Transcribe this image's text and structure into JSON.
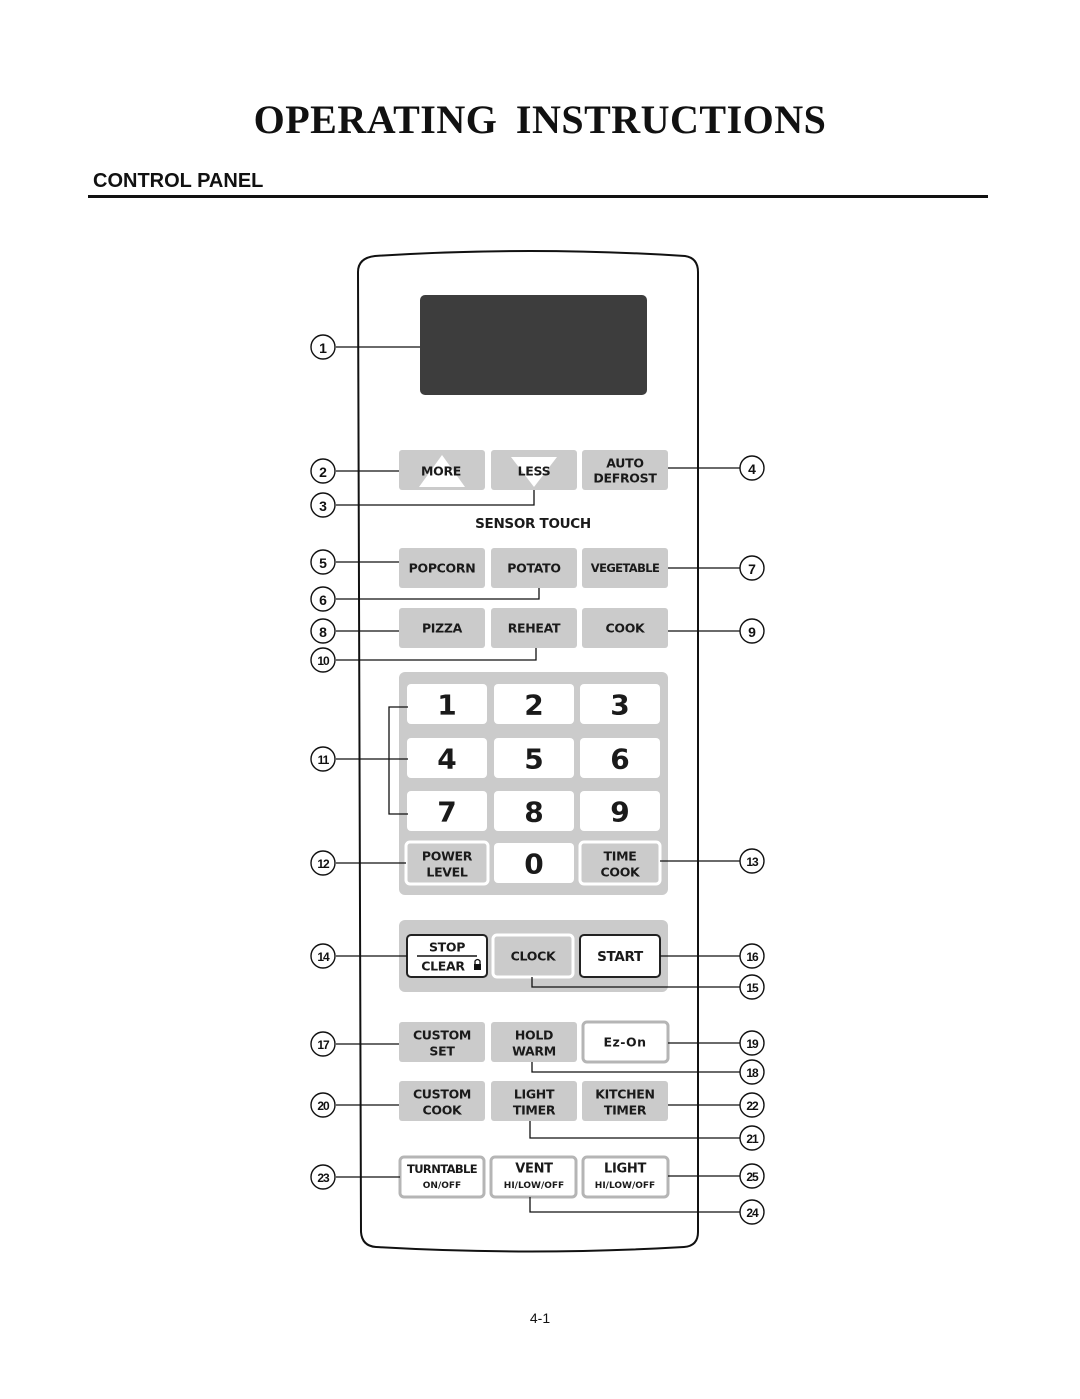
{
  "page": {
    "title": "OPERATING  INSTRUCTIONS",
    "section_title": "CONTROL PANEL",
    "page_number": "4-1"
  },
  "panel": {
    "sensor_heading": "SENSOR TOUCH",
    "buttons": {
      "more": {
        "label": "MORE",
        "callout": "2"
      },
      "less": {
        "label": "LESS",
        "callout": "3"
      },
      "auto_defrost": {
        "line1": "AUTO",
        "line2": "DEFROST",
        "callout": "4"
      },
      "popcorn": {
        "label": "POPCORN",
        "callout": "5"
      },
      "potato": {
        "label": "POTATO",
        "callout": "6"
      },
      "vegetable": {
        "label": "VEGETABLE",
        "callout": "7"
      },
      "pizza": {
        "label": "PIZZA",
        "callout": "8"
      },
      "cook": {
        "label": "COOK",
        "callout": "9"
      },
      "reheat": {
        "label": "REHEAT",
        "callout": "10"
      },
      "power_level": {
        "line1": "POWER",
        "line2": "LEVEL",
        "callout": "12"
      },
      "time_cook": {
        "line1": "TIME",
        "line2": "COOK",
        "callout": "13"
      },
      "stop_clear": {
        "line1": "STOP",
        "line2": "CLEAR",
        "callout": "14"
      },
      "clock": {
        "label": "CLOCK",
        "callout": "15"
      },
      "start": {
        "label": "START",
        "callout": "16"
      },
      "custom_set": {
        "line1": "CUSTOM",
        "line2": "SET",
        "callout": "17"
      },
      "hold_warm": {
        "line1": "HOLD",
        "line2": "WARM",
        "callout": "18"
      },
      "ez_on": {
        "label": "Ez-On",
        "callout": "19"
      },
      "custom_cook": {
        "line1": "CUSTOM",
        "line2": "COOK",
        "callout": "20"
      },
      "light_timer": {
        "line1": "LIGHT",
        "line2": "TIMER",
        "callout": "21"
      },
      "kitchen_timer": {
        "line1": "KITCHEN",
        "line2": "TIMER",
        "callout": "22"
      },
      "turntable": {
        "line1": "TURNTABLE",
        "line2": "ON/OFF",
        "callout": "23"
      },
      "vent": {
        "line1": "VENT",
        "line2": "HI/LOW/OFF",
        "callout": "24"
      },
      "light": {
        "line1": "LIGHT",
        "line2": "HI/LOW/OFF",
        "callout": "25"
      }
    },
    "digits": [
      "1",
      "2",
      "3",
      "4",
      "5",
      "6",
      "7",
      "8",
      "9",
      "0"
    ],
    "display_callout": "1",
    "number_pad_callout": "11"
  }
}
